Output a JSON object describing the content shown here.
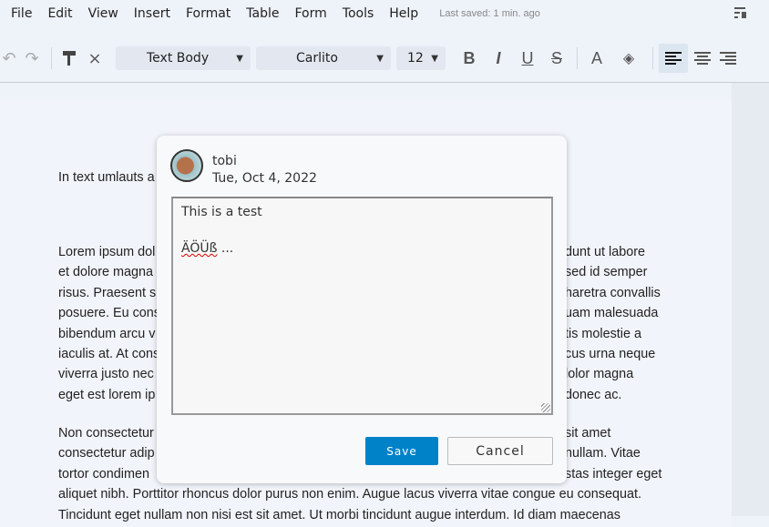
{
  "menu": {
    "items": [
      "File",
      "Edit",
      "View",
      "Insert",
      "Format",
      "Table",
      "Form",
      "Tools",
      "Help"
    ],
    "last_saved": "Last saved: 1 min. ago"
  },
  "toolbar": {
    "style": "Text Body",
    "font": "Carlito",
    "size": "12",
    "bold": "B",
    "italic": "I",
    "underline": "U",
    "strike": "S",
    "font_color": "A"
  },
  "document": {
    "heading_fragment": "In text umlauts a",
    "para1": [
      {
        "left": "Lorem ipsum dol",
        "right": "dunt ut labore"
      },
      {
        "left": "et dolore magna",
        "right": "sed id semper"
      },
      {
        "left": "risus. Praesent s",
        "right": "haretra convallis"
      },
      {
        "left": "posuere. Eu cons",
        "right": "uam malesuada"
      },
      {
        "left": "bibendum arcu v",
        "right": "tis molestie a"
      },
      {
        "left": "iaculis at. At cons",
        "right": "cus urna neque"
      },
      {
        "left": "viverra justo nec",
        "right": "lolor magna"
      },
      {
        "left": "eget est lorem ip",
        "right": "donec ac."
      }
    ],
    "para2": [
      {
        "left": "Non consectetur",
        "right": "sit amet"
      },
      {
        "left": "consectetur adip",
        "right": "nullam. Vitae"
      },
      {
        "left": "tortor condimen",
        "right": "stas integer eget"
      },
      {
        "left": "aliquet nibh. Porttitor rhoncus dolor purus non enim. Augue lacus viverra vitae congue eu consequat.",
        "right": ""
      },
      {
        "left": "Tincidunt eget nullam non nisi est sit amet. Ut morbi tincidunt augue interdum. Id diam maecenas",
        "right": ""
      }
    ]
  },
  "comment": {
    "author": "tobi",
    "date": "Tue, Oct 4, 2022",
    "line1": "This is a test",
    "line2_misspelled": "ÄÖÜß",
    "line2_rest": " ...",
    "save": "Save",
    "cancel": "Cancel"
  },
  "colors": {
    "accent": "#0082c9"
  }
}
